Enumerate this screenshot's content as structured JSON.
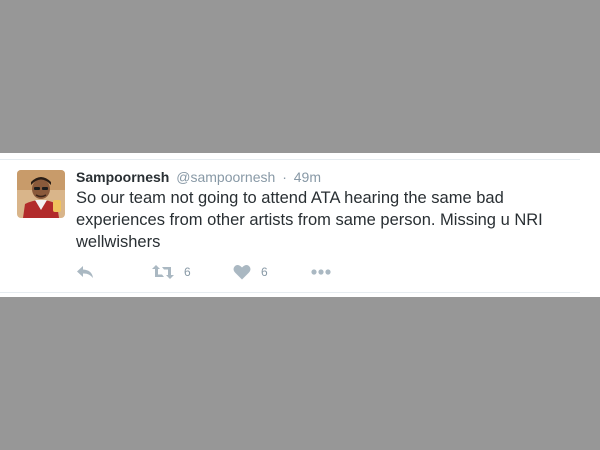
{
  "tweet": {
    "display_name": "Sampoornesh",
    "handle": "@sampoornesh",
    "separator": "·",
    "time": "49m",
    "text": "So our team not going to attend ATA hearing the same bad experiences from other artists from same person. Missing u NRI wellwishers",
    "retweet_count": "6",
    "like_count": "6"
  },
  "icons": {
    "reply": "reply-icon",
    "retweet": "retweet-icon",
    "like": "heart-icon",
    "more": "more-dots-icon"
  },
  "colors": {
    "backdrop": "#979797",
    "card": "#ffffff",
    "name": "#292f33",
    "meta": "#8899a6",
    "icon": "#aab8c2"
  }
}
